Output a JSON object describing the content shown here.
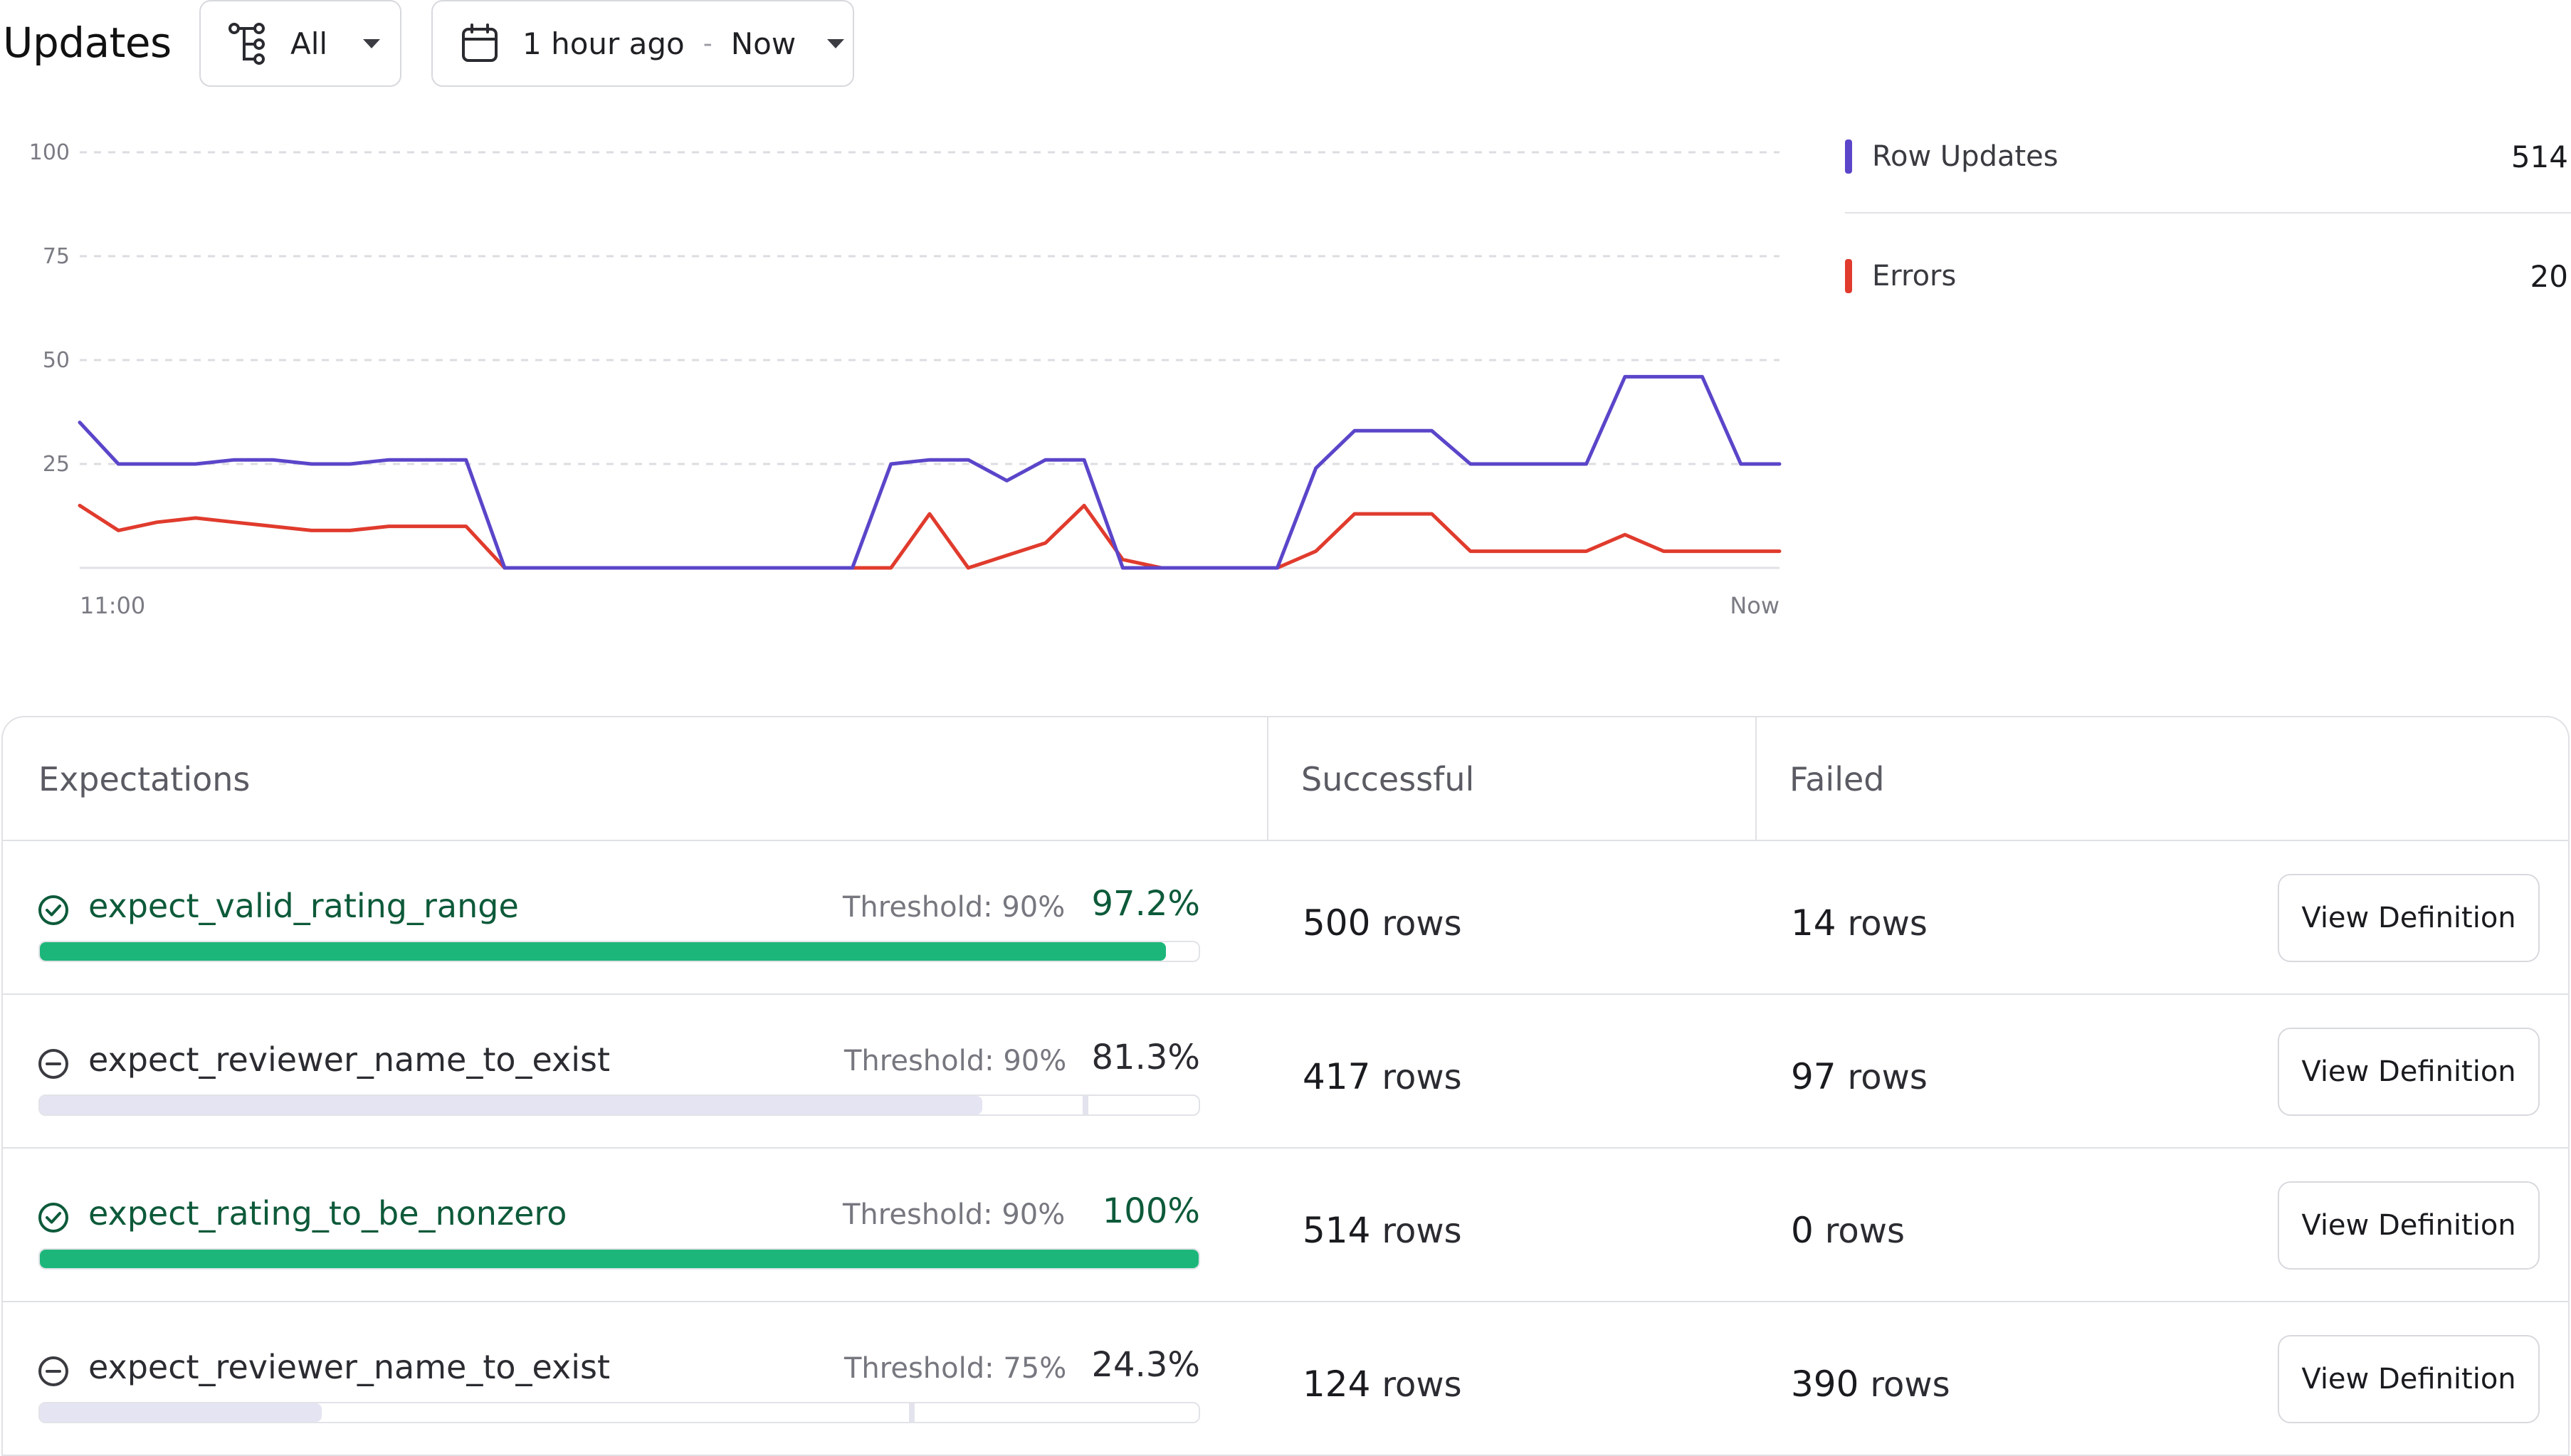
{
  "header": {
    "title": "Updates",
    "filter": {
      "icon": "hierarchy-icon",
      "label": "All"
    },
    "date_range": {
      "icon": "calendar-icon",
      "from": "1 hour ago",
      "separator": "-",
      "to": "Now"
    }
  },
  "legend": [
    {
      "label": "Row Updates",
      "value": "514",
      "color": "#5b45c9"
    },
    {
      "label": "Errors",
      "value": "20",
      "color": "#e03b2d"
    }
  ],
  "chart_data": {
    "type": "line",
    "x_labels": [
      "11:00",
      "Now"
    ],
    "y_ticks": [
      100,
      75,
      50,
      25
    ],
    "ylim": [
      0,
      100
    ],
    "grid": true,
    "legend_placement": "right",
    "series": [
      {
        "name": "Row Updates",
        "color": "#5b45c9",
        "values": [
          35,
          25,
          25,
          25,
          26,
          26,
          25,
          25,
          26,
          26,
          26,
          0,
          0,
          0,
          0,
          0,
          0,
          0,
          0,
          0,
          0,
          25,
          26,
          26,
          21,
          26,
          26,
          0,
          0,
          0,
          0,
          0,
          24,
          33,
          33,
          33,
          25,
          25,
          25,
          25,
          46,
          46,
          46,
          25,
          25
        ]
      },
      {
        "name": "Errors",
        "color": "#e03b2d",
        "values": [
          15,
          9,
          11,
          12,
          11,
          10,
          9,
          9,
          10,
          10,
          10,
          0,
          0,
          0,
          0,
          0,
          0,
          0,
          0,
          0,
          0,
          0,
          13,
          0,
          3,
          6,
          15,
          2,
          0,
          0,
          0,
          0,
          4,
          13,
          13,
          13,
          4,
          4,
          4,
          4,
          8,
          4,
          4,
          4,
          4
        ]
      }
    ]
  },
  "table": {
    "headers": {
      "expectations": "Expectations",
      "successful": "Successful",
      "failed": "Failed"
    },
    "rows": [
      {
        "status": "passed",
        "status_icon": "check-circle-icon",
        "name": "expect_valid_rating_range",
        "threshold_text": "Threshold: 90%",
        "threshold": 0.9,
        "percent_text": "97.2%",
        "percent": 0.972,
        "successful": "500",
        "failed": "14",
        "unit": "rows",
        "button": "View Definition"
      },
      {
        "status": "failed",
        "status_icon": "minus-circle-icon",
        "name": "expect_reviewer_name_to_exist",
        "threshold_text": "Threshold: 90%",
        "threshold": 0.9,
        "percent_text": "81.3%",
        "percent": 0.813,
        "successful": "417",
        "failed": "97",
        "unit": "rows",
        "button": "View Definition"
      },
      {
        "status": "passed",
        "status_icon": "check-circle-icon",
        "name": "expect_rating_to_be_nonzero",
        "threshold_text": "Threshold: 90%",
        "threshold": 0.9,
        "percent_text": "100%",
        "percent": 1.0,
        "successful": "514",
        "failed": "0",
        "unit": "rows",
        "button": "View Definition"
      },
      {
        "status": "failed",
        "status_icon": "minus-circle-icon",
        "name": "expect_reviewer_name_to_exist",
        "threshold_text": "Threshold: 75%",
        "threshold": 0.75,
        "percent_text": "24.3%",
        "percent": 0.243,
        "successful": "124",
        "failed": "390",
        "unit": "rows",
        "button": "View Definition"
      }
    ]
  }
}
